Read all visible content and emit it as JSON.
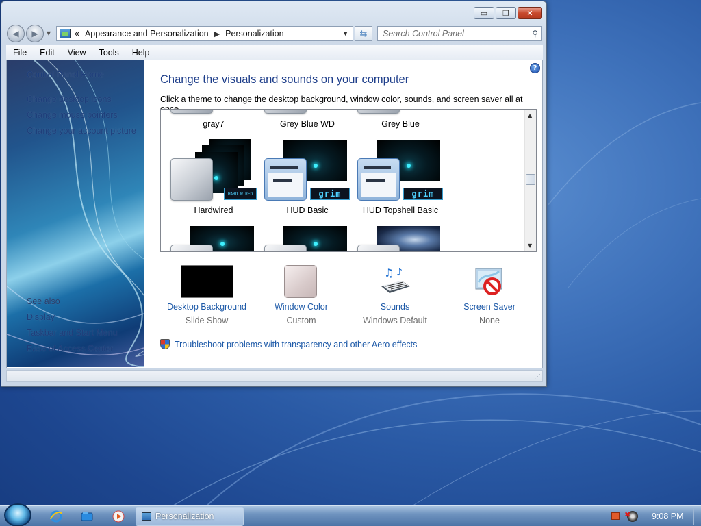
{
  "window": {
    "controls": {
      "minimize": "▭",
      "maximize": "❐",
      "close": "✕"
    }
  },
  "nav": {
    "back_icon": "back-arrow-icon",
    "forward_icon": "forward-arrow-icon",
    "breadcrumb_prefix": "«",
    "breadcrumb": [
      "Appearance and Personalization",
      "Personalization"
    ],
    "search_placeholder": "Search Control Panel"
  },
  "menu": [
    "File",
    "Edit",
    "View",
    "Tools",
    "Help"
  ],
  "sidebar": {
    "links": [
      "Control Panel Home",
      "Change desktop icons",
      "Change mouse pointers",
      "Change your account picture"
    ],
    "see_also_label": "See also",
    "see_also_links": [
      "Display",
      "Taskbar and Start Menu",
      "Ease of Access Center"
    ]
  },
  "main": {
    "heading": "Change the visuals and sounds on your computer",
    "subtext": "Click a theme to change the desktop background, window color, sounds, and screen saver all at once.",
    "themes": [
      {
        "name": "gray7"
      },
      {
        "name": "Grey Blue WD"
      },
      {
        "name": "Grey Blue"
      },
      {
        "name": "Hardwired"
      },
      {
        "name": "HUD Basic"
      },
      {
        "name": "HUD Topshell Basic"
      }
    ],
    "badges": {
      "grim": "grim",
      "hardwired": "HARD WIRED"
    },
    "options": [
      {
        "label": "Desktop Background",
        "sub": "Slide Show"
      },
      {
        "label": "Window Color",
        "sub": "Custom"
      },
      {
        "label": "Sounds",
        "sub": "Windows Default"
      },
      {
        "label": "Screen Saver",
        "sub": "None"
      }
    ],
    "troubleshoot": "Troubleshoot problems with transparency and other Aero effects"
  },
  "taskbar": {
    "task_label": "Personalization",
    "clock": "9:08 PM"
  }
}
